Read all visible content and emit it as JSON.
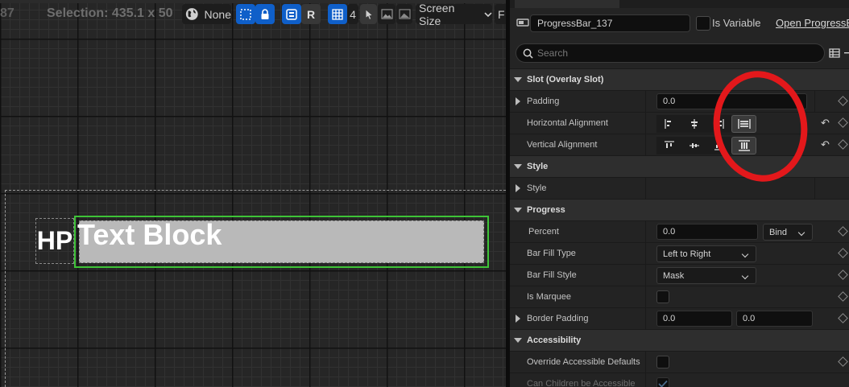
{
  "canvas_toolbar": {
    "zoom_fragment": "87",
    "selection_text": "Selection: 435.1 x 50",
    "localization_value": "None",
    "r_label": "R",
    "grid_snap_value": "4",
    "screen_size_label": "Screen Size",
    "cutoff_label": "F"
  },
  "canvas": {
    "hp_label": "HP",
    "text_block_label": "Text Block"
  },
  "details": {
    "widget_name": "ProgressBar_137",
    "is_variable_label": "Is Variable",
    "open_link": "Open ProgressBar",
    "search_placeholder": "Search",
    "categories": {
      "slot": "Slot (Overlay Slot)",
      "style": "Style",
      "progress": "Progress",
      "accessibility": "Accessibility"
    },
    "props": {
      "padding": {
        "label": "Padding",
        "value": "0.0"
      },
      "horizontal_alignment": {
        "label": "Horizontal Alignment",
        "selected": "fill"
      },
      "vertical_alignment": {
        "label": "Vertical Alignment",
        "selected": "fill"
      },
      "style": {
        "label": "Style"
      },
      "percent": {
        "label": "Percent",
        "value": "0.0",
        "bind_label": "Bind"
      },
      "bar_fill_type": {
        "label": "Bar Fill Type",
        "value": "Left to Right"
      },
      "bar_fill_style": {
        "label": "Bar Fill Style",
        "value": "Mask"
      },
      "is_marquee": {
        "label": "Is Marquee",
        "checked": false
      },
      "border_padding": {
        "label": "Border Padding",
        "x": "0.0",
        "y": "0.0"
      },
      "override_accessible": {
        "label": "Override Accessible Defaults",
        "checked": false
      },
      "can_children": {
        "label": "Can Children be Accessible",
        "checked": true
      }
    }
  },
  "colors": {
    "selection_outline": "#3ec337",
    "annotation_circle": "#e3181b",
    "toolbar_blue": "#0f5fc9"
  }
}
